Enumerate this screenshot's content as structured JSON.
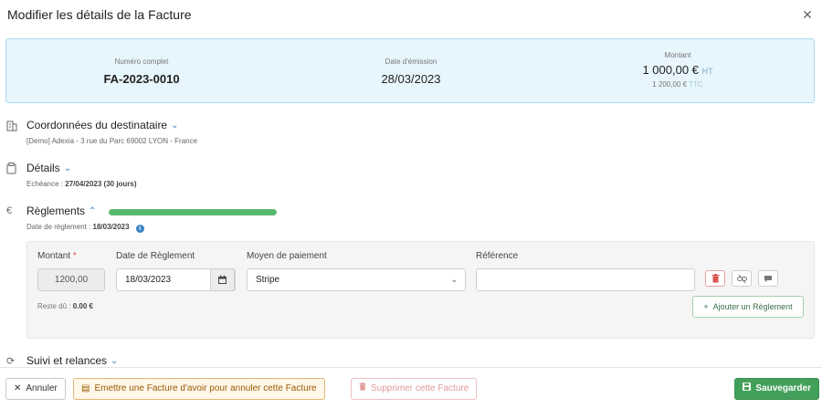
{
  "modal": {
    "title": "Modifier les détails de la Facture",
    "close_icon": "close-icon"
  },
  "summary": {
    "numero": {
      "label": "Numéro complet",
      "value": "FA-2023-0010"
    },
    "date": {
      "label": "Date d'émission",
      "value": "28/03/2023"
    },
    "montant": {
      "label": "Montant",
      "ht_value": "1 000,00 €",
      "ht_unit": "HT",
      "ttc_value": "1 200,00 €",
      "ttc_unit": "TTC"
    }
  },
  "sections": {
    "destinataire": {
      "title": "Coordonnées du destinataire",
      "subtitle": "[Demo] Adexia - 3 rue du Parc 69002 LYON - France",
      "icon": "building-icon"
    },
    "details": {
      "title": "Détails",
      "subtitle_label": "Echéance :",
      "subtitle_value": "27/04/2023 (30 jours)",
      "icon": "clipboard-icon"
    },
    "reglements": {
      "title": "Règlements",
      "progress": 1.0,
      "subtitle_label": "Date de règlement :",
      "subtitle_value": "18/03/2023",
      "icon": "euro-icon"
    },
    "suivi": {
      "title": "Suivi et relances",
      "icon": "refresh-icon"
    }
  },
  "payment": {
    "montant_label": "Montant",
    "required_mark": "*",
    "montant_value": "1200,00",
    "date_label": "Date de Règlement",
    "date_value": "18/03/2023",
    "moyen_label": "Moyen de paiement",
    "moyen_value": "Stripe",
    "reference_label": "Référence",
    "reference_value": "",
    "reste_label": "Reste dû :",
    "reste_value": "0.00 €",
    "add_label": "Ajouter un Règlement"
  },
  "footer": {
    "cancel_label": "Annuler",
    "avoir_label": "Emettre une Facture d'avoir pour annuler cette Facture",
    "delete_label": "Supprimer cette Facture",
    "save_label": "Sauvegarder"
  },
  "colors": {
    "accent": "#3b84c4",
    "success": "#43a05b",
    "progress": "#57b86b",
    "summary_bg": "#e7f5fc"
  }
}
